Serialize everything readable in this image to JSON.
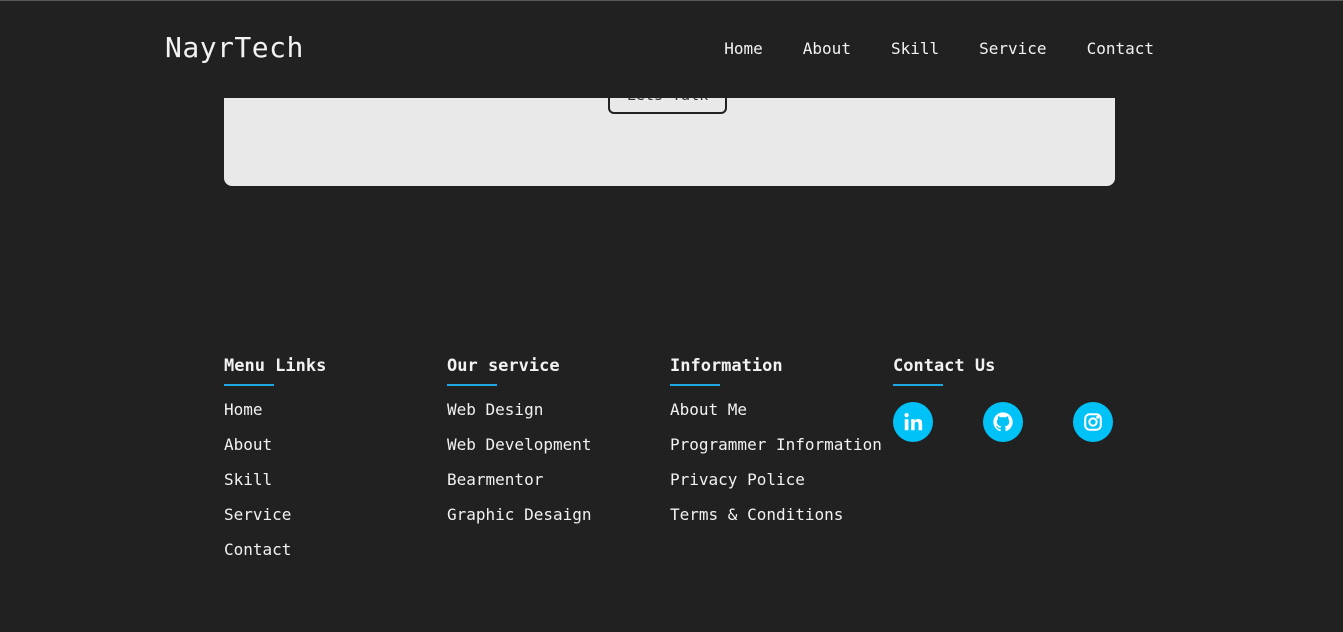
{
  "header": {
    "brand": "NayrTech",
    "nav": [
      "Home",
      "About",
      "Skill",
      "Service",
      "Contact"
    ]
  },
  "cta": {
    "button_label": "Lets Talk"
  },
  "footer": {
    "columns": [
      {
        "title": "Menu Links",
        "links": [
          "Home",
          "About",
          "Skill",
          "Service",
          "Contact"
        ]
      },
      {
        "title": "Our service",
        "links": [
          "Web Design",
          "Web Development",
          "Bearmentor",
          "Graphic Desaign"
        ]
      },
      {
        "title": "Information",
        "links": [
          "About Me",
          "Programmer Information",
          "Privacy Police",
          "Terms & Conditions"
        ]
      },
      {
        "title": "Contact Us",
        "socials": [
          "linkedin-icon",
          "github-icon",
          "instagram-icon"
        ]
      }
    ]
  },
  "colors": {
    "background": "#212121",
    "accent": "#00c2f7",
    "card": "#e9e9e9"
  }
}
